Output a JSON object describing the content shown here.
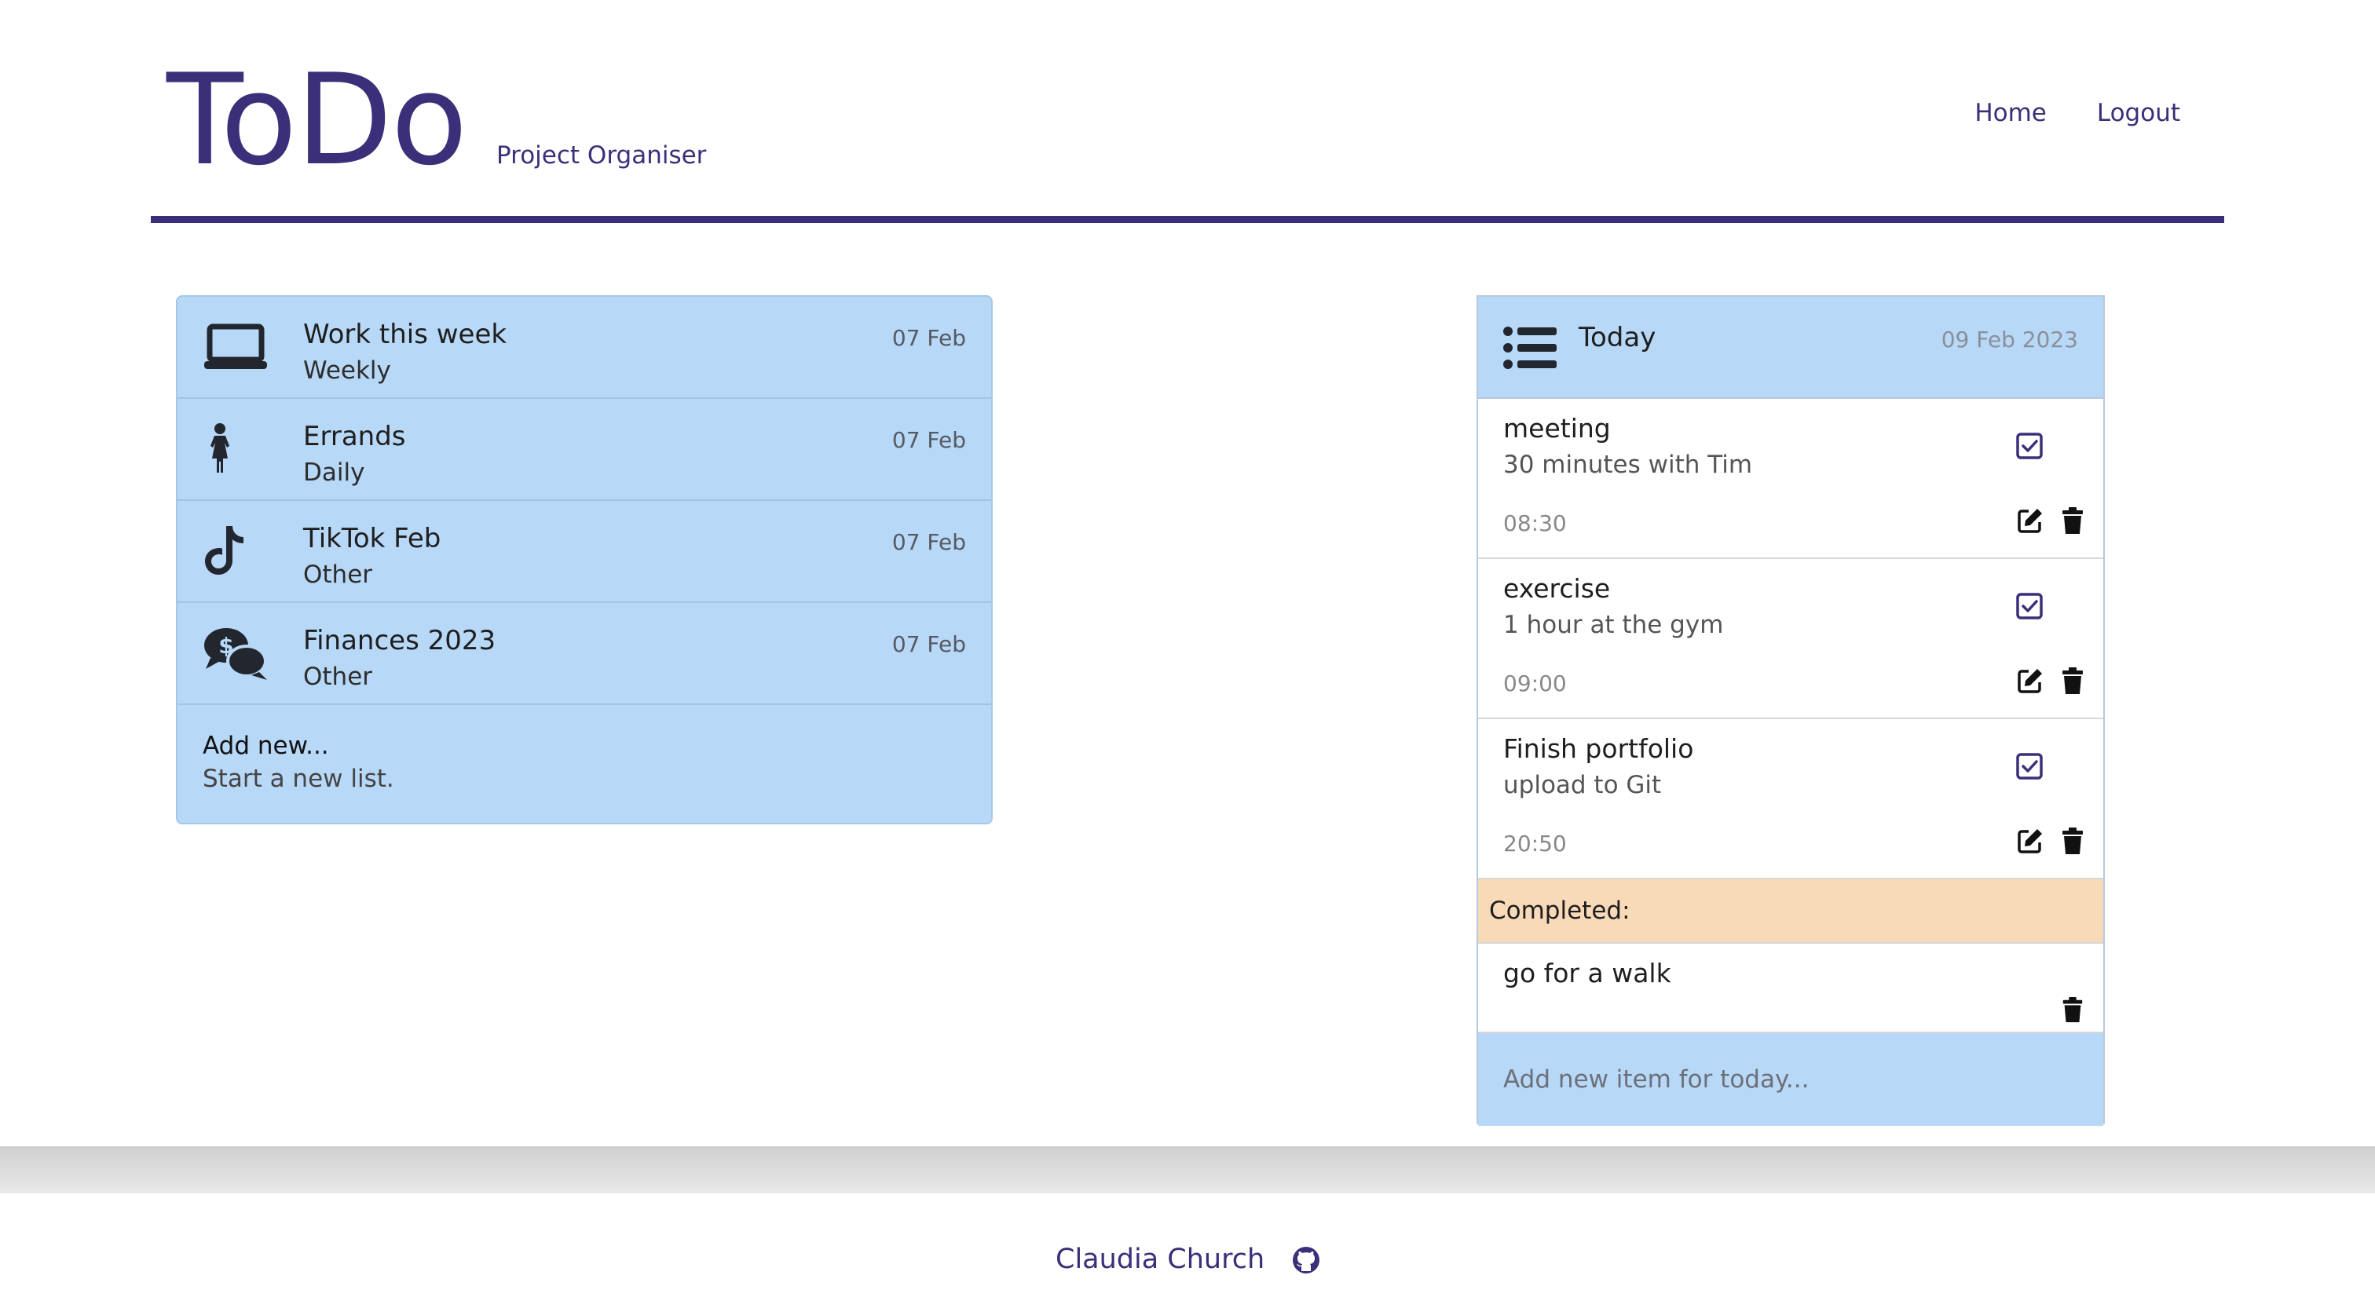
{
  "header": {
    "title": "ToDo",
    "subtitle": "Project Organiser",
    "nav": [
      {
        "label": "Home"
      },
      {
        "label": "Logout"
      }
    ],
    "accent_color": "#3c2f7a"
  },
  "lists": {
    "background_color": "#b8d8f8",
    "items": [
      {
        "name": "Work this week",
        "frequency": "Weekly",
        "date": "07 Feb",
        "icon": "laptop-icon"
      },
      {
        "name": "Errands",
        "frequency": "Daily",
        "date": "07 Feb",
        "icon": "child-icon"
      },
      {
        "name": "TikTok Feb",
        "frequency": "Other",
        "date": "07 Feb",
        "icon": "tiktok-icon"
      },
      {
        "name": "Finances 2023",
        "frequency": "Other",
        "date": "07 Feb",
        "icon": "money-chat-icon"
      }
    ],
    "add_new": {
      "title": "Add new...",
      "hint": "Start a new list."
    }
  },
  "today": {
    "title": "Today",
    "date": "09 Feb 2023",
    "icon": "list-icon",
    "tasks": [
      {
        "name": "meeting",
        "description": "30 minutes with Tim",
        "time": "08:30"
      },
      {
        "name": "exercise",
        "description": "1 hour at the gym",
        "time": "09:00"
      },
      {
        "name": "Finish portfolio",
        "description": "upload to Git",
        "time": "20:50"
      }
    ],
    "completed_label": "Completed:",
    "completed": [
      {
        "name": "go for a walk"
      }
    ],
    "add_placeholder": "Add new item for today...",
    "completed_color": "#f8dab9"
  },
  "footer": {
    "author": "Claudia Church",
    "icon": "github-icon"
  }
}
